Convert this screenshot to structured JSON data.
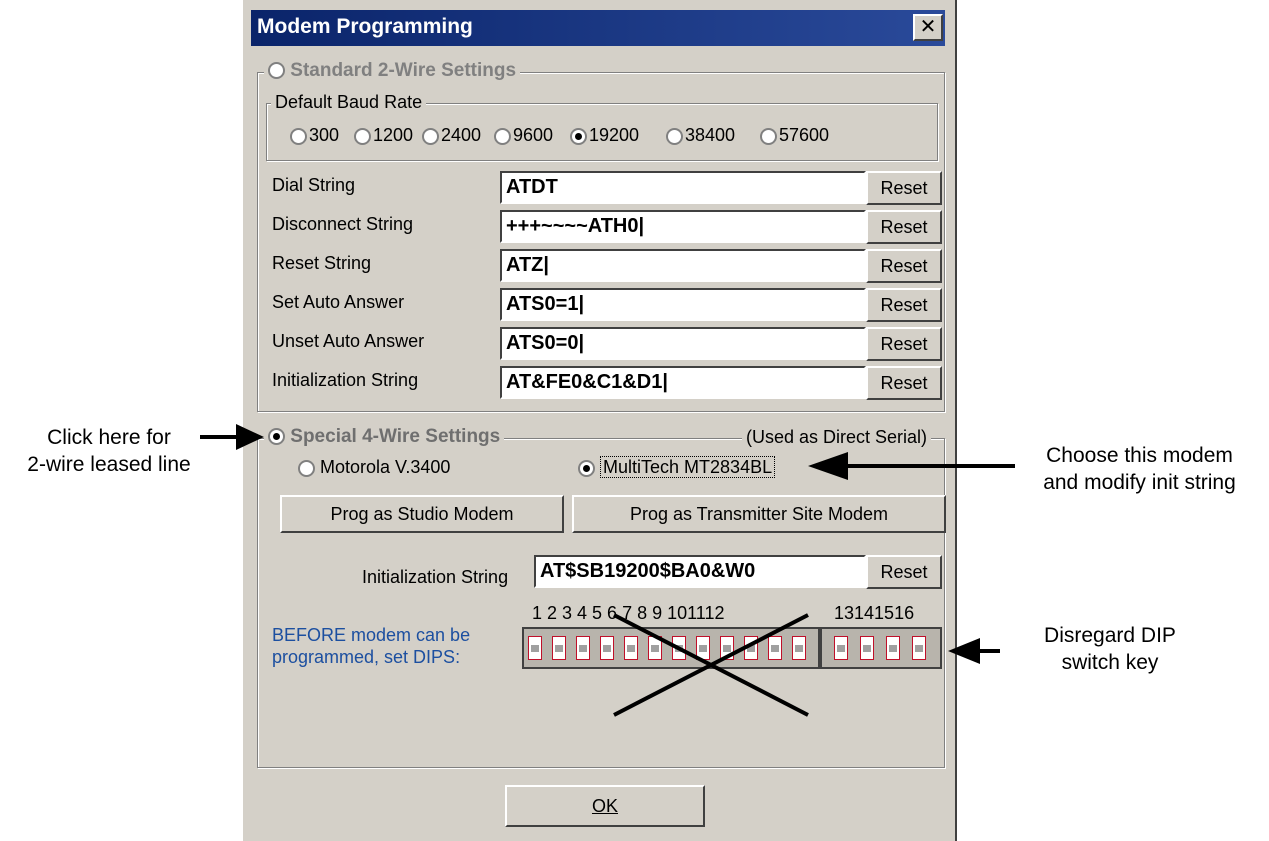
{
  "window": {
    "title": "Modem Programming",
    "close_glyph": "✕"
  },
  "standard": {
    "legend": "Standard 2-Wire Settings",
    "baud_legend": "Default Baud Rate",
    "baud_rates": [
      "300",
      "1200",
      "2400",
      "9600",
      "19200",
      "38400",
      "57600"
    ],
    "baud_selected": "19200",
    "rows": [
      {
        "label": "Dial String",
        "value": "ATDT"
      },
      {
        "label": "Disconnect String",
        "value": "+++~~~~ATH0|"
      },
      {
        "label": "Reset String",
        "value": "ATZ|"
      },
      {
        "label": "Set Auto Answer",
        "value": "ATS0=1|"
      },
      {
        "label": "Unset Auto Answer",
        "value": "ATS0=0|"
      },
      {
        "label": "Initialization String",
        "value": "AT&FE0&C1&D1|"
      }
    ],
    "reset_label": "Reset"
  },
  "special": {
    "legend": "Special 4-Wire Settings",
    "note": "(Used as Direct Serial)",
    "modem_1": "Motorola V.3400",
    "modem_2": "MultiTech MT2834BL",
    "prog_studio": "Prog as Studio Modem",
    "prog_transmitter": "Prog as Transmitter Site Modem",
    "init_label": "Initialization String",
    "init_value": "AT$SB19200$BA0&W0",
    "reset_label": "Reset",
    "dip_text_1": "BEFORE modem can be",
    "dip_text_2": "programmed, set DIPS:",
    "dip_numbers_a": "1 2 3 4 5 6 7 8 9 101112",
    "dip_numbers_b": "13141516"
  },
  "ok_label": "OK",
  "annotations": {
    "left_1": "Click here for",
    "left_2": "2-wire leased line",
    "right_1": "Choose this modem",
    "right_2": "and modify init string",
    "dip_1": "Disregard DIP",
    "dip_2": "switch key"
  },
  "colors": {
    "title_bar": "#0a246a",
    "dip_text": "#1c4fa0",
    "dip_switch": "#c0102a"
  }
}
